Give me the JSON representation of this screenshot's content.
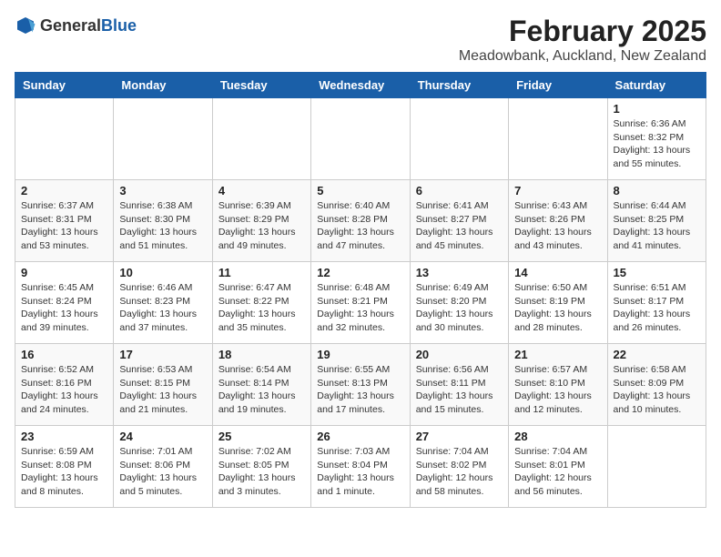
{
  "header": {
    "logo_general": "General",
    "logo_blue": "Blue",
    "title": "February 2025",
    "subtitle": "Meadowbank, Auckland, New Zealand"
  },
  "days_of_week": [
    "Sunday",
    "Monday",
    "Tuesday",
    "Wednesday",
    "Thursday",
    "Friday",
    "Saturday"
  ],
  "weeks": [
    [
      {
        "day": "",
        "info": ""
      },
      {
        "day": "",
        "info": ""
      },
      {
        "day": "",
        "info": ""
      },
      {
        "day": "",
        "info": ""
      },
      {
        "day": "",
        "info": ""
      },
      {
        "day": "",
        "info": ""
      },
      {
        "day": "1",
        "info": "Sunrise: 6:36 AM\nSunset: 8:32 PM\nDaylight: 13 hours\nand 55 minutes."
      }
    ],
    [
      {
        "day": "2",
        "info": "Sunrise: 6:37 AM\nSunset: 8:31 PM\nDaylight: 13 hours\nand 53 minutes."
      },
      {
        "day": "3",
        "info": "Sunrise: 6:38 AM\nSunset: 8:30 PM\nDaylight: 13 hours\nand 51 minutes."
      },
      {
        "day": "4",
        "info": "Sunrise: 6:39 AM\nSunset: 8:29 PM\nDaylight: 13 hours\nand 49 minutes."
      },
      {
        "day": "5",
        "info": "Sunrise: 6:40 AM\nSunset: 8:28 PM\nDaylight: 13 hours\nand 47 minutes."
      },
      {
        "day": "6",
        "info": "Sunrise: 6:41 AM\nSunset: 8:27 PM\nDaylight: 13 hours\nand 45 minutes."
      },
      {
        "day": "7",
        "info": "Sunrise: 6:43 AM\nSunset: 8:26 PM\nDaylight: 13 hours\nand 43 minutes."
      },
      {
        "day": "8",
        "info": "Sunrise: 6:44 AM\nSunset: 8:25 PM\nDaylight: 13 hours\nand 41 minutes."
      }
    ],
    [
      {
        "day": "9",
        "info": "Sunrise: 6:45 AM\nSunset: 8:24 PM\nDaylight: 13 hours\nand 39 minutes."
      },
      {
        "day": "10",
        "info": "Sunrise: 6:46 AM\nSunset: 8:23 PM\nDaylight: 13 hours\nand 37 minutes."
      },
      {
        "day": "11",
        "info": "Sunrise: 6:47 AM\nSunset: 8:22 PM\nDaylight: 13 hours\nand 35 minutes."
      },
      {
        "day": "12",
        "info": "Sunrise: 6:48 AM\nSunset: 8:21 PM\nDaylight: 13 hours\nand 32 minutes."
      },
      {
        "day": "13",
        "info": "Sunrise: 6:49 AM\nSunset: 8:20 PM\nDaylight: 13 hours\nand 30 minutes."
      },
      {
        "day": "14",
        "info": "Sunrise: 6:50 AM\nSunset: 8:19 PM\nDaylight: 13 hours\nand 28 minutes."
      },
      {
        "day": "15",
        "info": "Sunrise: 6:51 AM\nSunset: 8:17 PM\nDaylight: 13 hours\nand 26 minutes."
      }
    ],
    [
      {
        "day": "16",
        "info": "Sunrise: 6:52 AM\nSunset: 8:16 PM\nDaylight: 13 hours\nand 24 minutes."
      },
      {
        "day": "17",
        "info": "Sunrise: 6:53 AM\nSunset: 8:15 PM\nDaylight: 13 hours\nand 21 minutes."
      },
      {
        "day": "18",
        "info": "Sunrise: 6:54 AM\nSunset: 8:14 PM\nDaylight: 13 hours\nand 19 minutes."
      },
      {
        "day": "19",
        "info": "Sunrise: 6:55 AM\nSunset: 8:13 PM\nDaylight: 13 hours\nand 17 minutes."
      },
      {
        "day": "20",
        "info": "Sunrise: 6:56 AM\nSunset: 8:11 PM\nDaylight: 13 hours\nand 15 minutes."
      },
      {
        "day": "21",
        "info": "Sunrise: 6:57 AM\nSunset: 8:10 PM\nDaylight: 13 hours\nand 12 minutes."
      },
      {
        "day": "22",
        "info": "Sunrise: 6:58 AM\nSunset: 8:09 PM\nDaylight: 13 hours\nand 10 minutes."
      }
    ],
    [
      {
        "day": "23",
        "info": "Sunrise: 6:59 AM\nSunset: 8:08 PM\nDaylight: 13 hours\nand 8 minutes."
      },
      {
        "day": "24",
        "info": "Sunrise: 7:01 AM\nSunset: 8:06 PM\nDaylight: 13 hours\nand 5 minutes."
      },
      {
        "day": "25",
        "info": "Sunrise: 7:02 AM\nSunset: 8:05 PM\nDaylight: 13 hours\nand 3 minutes."
      },
      {
        "day": "26",
        "info": "Sunrise: 7:03 AM\nSunset: 8:04 PM\nDaylight: 13 hours\nand 1 minute."
      },
      {
        "day": "27",
        "info": "Sunrise: 7:04 AM\nSunset: 8:02 PM\nDaylight: 12 hours\nand 58 minutes."
      },
      {
        "day": "28",
        "info": "Sunrise: 7:04 AM\nSunset: 8:01 PM\nDaylight: 12 hours\nand 56 minutes."
      },
      {
        "day": "",
        "info": ""
      }
    ]
  ]
}
